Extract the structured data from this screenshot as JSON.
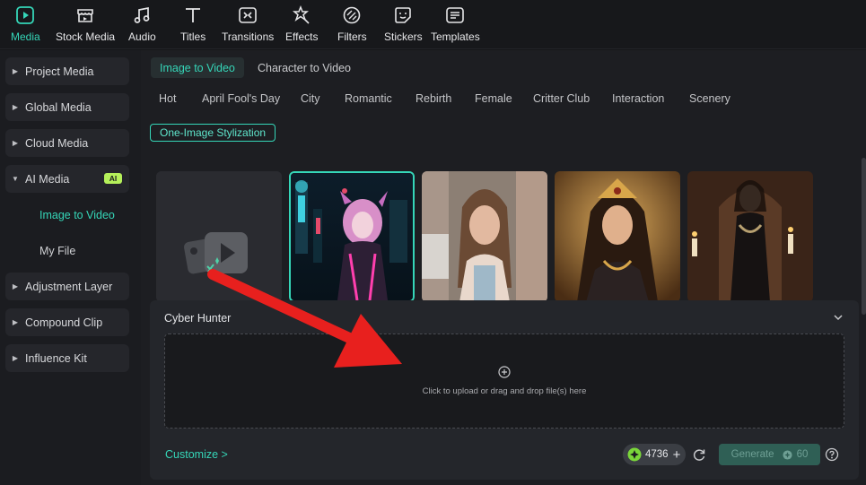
{
  "toolbar": {
    "items": [
      {
        "label": "Media",
        "icon": "media-icon",
        "active": true
      },
      {
        "label": "Stock Media",
        "icon": "stock-media-icon"
      },
      {
        "label": "Audio",
        "icon": "music-note-icon"
      },
      {
        "label": "Titles",
        "icon": "text-t-icon"
      },
      {
        "label": "Transitions",
        "icon": "transitions-icon"
      },
      {
        "label": "Effects",
        "icon": "effects-icon"
      },
      {
        "label": "Filters",
        "icon": "filters-icon"
      },
      {
        "label": "Stickers",
        "icon": "stickers-icon"
      },
      {
        "label": "Templates",
        "icon": "templates-icon"
      }
    ]
  },
  "sidebar": {
    "items": [
      {
        "label": "Project Media"
      },
      {
        "label": "Global Media"
      },
      {
        "label": "Cloud Media"
      },
      {
        "label": "AI Media",
        "badge": "AI",
        "expanded": true
      },
      {
        "label": "Adjustment Layer"
      },
      {
        "label": "Compound Clip"
      },
      {
        "label": "Influence Kit"
      }
    ],
    "subitems": [
      {
        "label": "Image to Video",
        "active": true
      },
      {
        "label": "My File"
      }
    ]
  },
  "main": {
    "tabs": [
      {
        "label": "Image to Video",
        "active": true
      },
      {
        "label": "Character to Video"
      }
    ],
    "categories": [
      "Hot",
      "April Fool's Day",
      "City",
      "Romantic",
      "Rebirth",
      "Female",
      "Critter Club",
      "Interaction",
      "Scenery"
    ],
    "chip": "One-Image Stylization"
  },
  "panel": {
    "title": "Cyber Hunter",
    "upload_text": "Click to upload or drag and drop file(s) here",
    "customize": "Customize >",
    "credits": "4736",
    "generate_label": "Generate",
    "generate_cost": "60"
  },
  "colors": {
    "accent": "#35d6b8",
    "annotation_arrow": "#e8201e",
    "ai_badge": "#b5f05a"
  }
}
